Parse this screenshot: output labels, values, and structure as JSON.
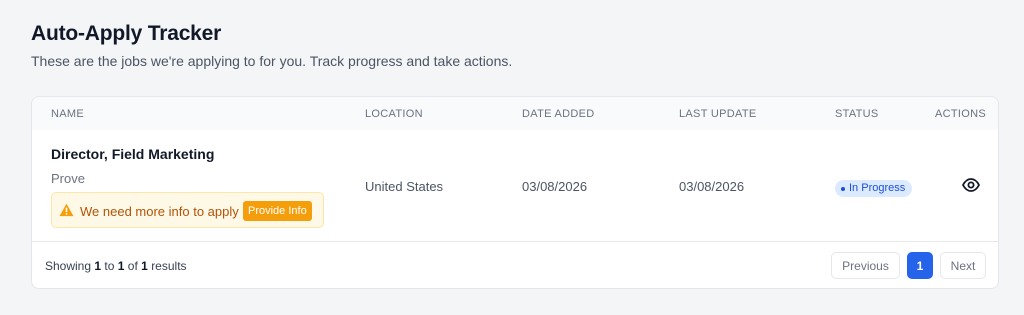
{
  "header": {
    "title": "Auto-Apply Tracker",
    "subtitle": "These are the jobs we're applying to for you. Track progress and take actions."
  },
  "table": {
    "columns": [
      "NAME",
      "LOCATION",
      "DATE ADDED",
      "LAST UPDATE",
      "STATUS",
      "ACTIONS"
    ],
    "rows": [
      {
        "title": "Director, Field Marketing",
        "company": "Prove",
        "alert_text": "We need more info to apply",
        "alert_button": "Provide Info",
        "alert_icon": "warning-icon",
        "location": "United States",
        "date_added": "03/08/2026",
        "last_update": "03/08/2026",
        "status": "In Progress",
        "action_icon": "eye-icon"
      }
    ]
  },
  "footer": {
    "showing": "Showing",
    "from": "1",
    "to_word": "to",
    "to": "1",
    "of_word": "of",
    "total": "1",
    "results_word": "results"
  },
  "pagination": {
    "previous": "Previous",
    "current_page": "1",
    "next": "Next"
  },
  "colors": {
    "accent": "#2563eb",
    "warning": "#f59e0b",
    "status_bg": "#dbeafe",
    "status_text": "#1d4ed8"
  }
}
